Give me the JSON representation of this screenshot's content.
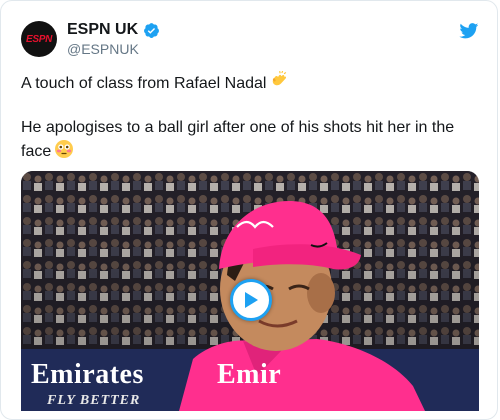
{
  "account": {
    "display_name": "ESPN UK",
    "handle": "@ESPNUK",
    "avatar_logo_text": "ESPN",
    "verified": true
  },
  "tweet": {
    "line1": "A touch of class from Rafael Nadal",
    "line1_emoji": "clapping-hands",
    "line2": "He apologises to a ball girl after one of his shots hit her in the face",
    "line2_emoji": "flushed-face"
  },
  "media": {
    "type": "video",
    "sponsor_left": "Emirates",
    "sponsor_right": "Emir",
    "slogan": "FLY BETTER"
  },
  "colors": {
    "twitter_blue": "#1da1f2",
    "espn_red": "#e8112d",
    "cap_pink": "#ff2f8e"
  },
  "icons": {
    "brand": "twitter-bird-icon",
    "verified": "verified-badge-icon",
    "play": "play-icon"
  }
}
